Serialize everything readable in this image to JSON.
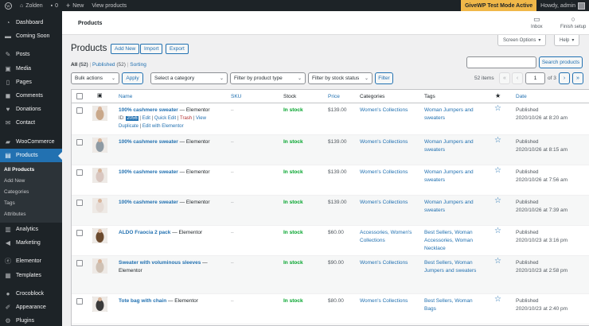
{
  "admin_bar": {
    "site_name": "Zolden",
    "comments_count": "0",
    "new_label": "New",
    "view_label": "View products",
    "givewp_label": "GiveWP Test Mode Active",
    "howdy": "Howdy, admin"
  },
  "sidebar": {
    "items": [
      {
        "label": "Dashboard",
        "icon": "dashboard-icon"
      },
      {
        "label": "Coming Soon",
        "icon": "coming-soon-icon"
      },
      {
        "label": "Posts",
        "icon": "pin-icon"
      },
      {
        "label": "Media",
        "icon": "media-icon"
      },
      {
        "label": "Pages",
        "icon": "pages-icon"
      },
      {
        "label": "Comments",
        "icon": "comments-icon"
      },
      {
        "label": "Donations",
        "icon": "donations-icon"
      },
      {
        "label": "Contact",
        "icon": "contact-icon"
      },
      {
        "label": "WooCommerce",
        "icon": "woocommerce-icon"
      },
      {
        "label": "Products",
        "icon": "products-icon"
      }
    ],
    "submenu": [
      "All Products",
      "Add New",
      "Categories",
      "Tags",
      "Attributes"
    ],
    "items_after": [
      {
        "label": "Analytics",
        "icon": "analytics-icon"
      },
      {
        "label": "Marketing",
        "icon": "marketing-icon"
      },
      {
        "label": "Elementor",
        "icon": "elementor-icon"
      },
      {
        "label": "Templates",
        "icon": "templates-icon"
      },
      {
        "label": "Crocoblock",
        "icon": "crocoblock-icon"
      },
      {
        "label": "Appearance",
        "icon": "appearance-icon"
      },
      {
        "label": "Plugins",
        "icon": "plugins-icon"
      }
    ]
  },
  "header": {
    "page_name": "Products",
    "inbox_label": "Inbox",
    "finish_label": "Finish setup",
    "screen_options": "Screen Options",
    "help": "Help"
  },
  "title_row": {
    "title": "Products",
    "add_new": "Add New",
    "import": "Import",
    "export": "Export"
  },
  "views": {
    "all": "All",
    "all_count": "(52)",
    "published": "Published",
    "published_count": "(52)",
    "sorting": "Sorting"
  },
  "search": {
    "button": "Search products"
  },
  "filters": {
    "bulk_actions": "Bulk actions",
    "apply": "Apply",
    "category": "Select a category",
    "product_type": "Filter by product type",
    "stock_status": "Filter by stock status",
    "filter": "Filter"
  },
  "pagination": {
    "items": "52 items",
    "first": "«",
    "prev": "‹",
    "current": "1",
    "of": "of 3",
    "next": "›",
    "last": "»"
  },
  "columns": {
    "name": "Name",
    "sku": "SKU",
    "stock": "Stock",
    "price": "Price",
    "categories": "Categories",
    "tags": "Tags",
    "date": "Date"
  },
  "row_actions": {
    "id_prefix": "ID:",
    "id_value": "2056",
    "edit": "Edit",
    "quick_edit": "Quick Edit",
    "trash": "Trash",
    "view": "View",
    "duplicate": "Duplicate",
    "edit_elementor": "Edit with Elementor"
  },
  "products": [
    {
      "name": "100% cashmere sweater",
      "suffix": " — Elementor",
      "sku": "–",
      "stock": "In stock",
      "price": "$139.00",
      "categories": [
        "Women's Collections"
      ],
      "tags": [
        "Woman Jumpers and",
        "sweaters"
      ],
      "status": "Published",
      "date": "2020/10/26 at 8:20 am",
      "thumb_color": "#c9a88a"
    },
    {
      "name": "100% cashmere sweater",
      "suffix": " — Elementor",
      "sku": "–",
      "stock": "In stock",
      "price": "$139.00",
      "categories": [
        "Women's Collections"
      ],
      "tags": [
        "Woman Jumpers and",
        "sweaters"
      ],
      "status": "Published",
      "date": "2020/10/26 at 8:15 am",
      "thumb_color": "#8e9aa3"
    },
    {
      "name": "100% cashmere sweater",
      "suffix": " — Elementor",
      "sku": "–",
      "stock": "In stock",
      "price": "$139.00",
      "categories": [
        "Women's Collections"
      ],
      "tags": [
        "Woman Jumpers and",
        "sweaters"
      ],
      "status": "Published",
      "date": "2020/10/26 at 7:56 am",
      "thumb_color": "#d9c7c0"
    },
    {
      "name": "100% cashmere sweater",
      "suffix": " — Elementor",
      "sku": "–",
      "stock": "In stock",
      "price": "$139.00",
      "categories": [
        "Women's Collections"
      ],
      "tags": [
        "Woman Jumpers and",
        "sweaters"
      ],
      "status": "Published",
      "date": "2020/10/26 at 7:39 am",
      "thumb_color": "#e6dcd6"
    },
    {
      "name": "ALDO Fraocia 2 pack",
      "suffix": " — Elementor",
      "sku": "–",
      "stock": "In stock",
      "price": "$60.00",
      "categories": [
        "Accessories, Women's",
        "Collections"
      ],
      "tags": [
        "Best Sellers, Woman",
        "Accessories, Woman",
        "Necklace"
      ],
      "status": "Published",
      "date": "2020/10/23 at 3:16 pm",
      "thumb_color": "#6b4a2e"
    },
    {
      "name": "Sweater with voluminous sleeves",
      "suffix": " —",
      "suffix2": "Elementor",
      "sku": "–",
      "stock": "In stock",
      "price": "$90.00",
      "categories": [
        "Women's Collections"
      ],
      "tags": [
        "Best Sellers, Woman",
        "Jumpers and sweaters"
      ],
      "status": "Published",
      "date": "2020/10/23 at 2:58 pm",
      "thumb_color": "#cfc1b4"
    },
    {
      "name": "Tote bag with chain",
      "suffix": " — Elementor",
      "sku": "–",
      "stock": "In stock",
      "price": "$80.00",
      "categories": [
        "Women's Collections"
      ],
      "tags": [
        "Best Sellers, Woman",
        "Bags"
      ],
      "status": "Published",
      "date": "2020/10/23 at 2:40 pm",
      "thumb_color": "#3a3a3a"
    }
  ],
  "colors": {
    "sidebar_bg": "#1d2327",
    "accent": "#2271b1",
    "in_stock": "#00a32a",
    "givewp": "#f0b849"
  }
}
